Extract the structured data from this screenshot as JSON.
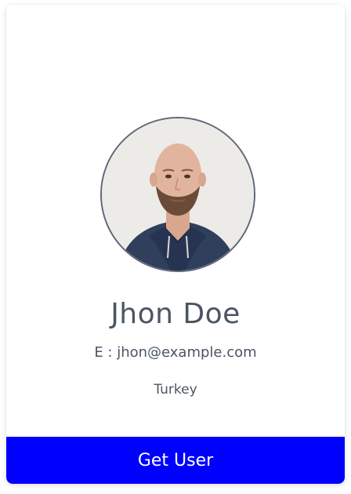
{
  "user": {
    "name": "Jhon Doe",
    "email": "E : jhon@example.com",
    "country": "Turkey"
  },
  "actions": {
    "get_user_label": "Get User"
  },
  "colors": {
    "button_bg": "#0000ff",
    "text": "#4b5563",
    "avatar_border": "#5f6678"
  }
}
